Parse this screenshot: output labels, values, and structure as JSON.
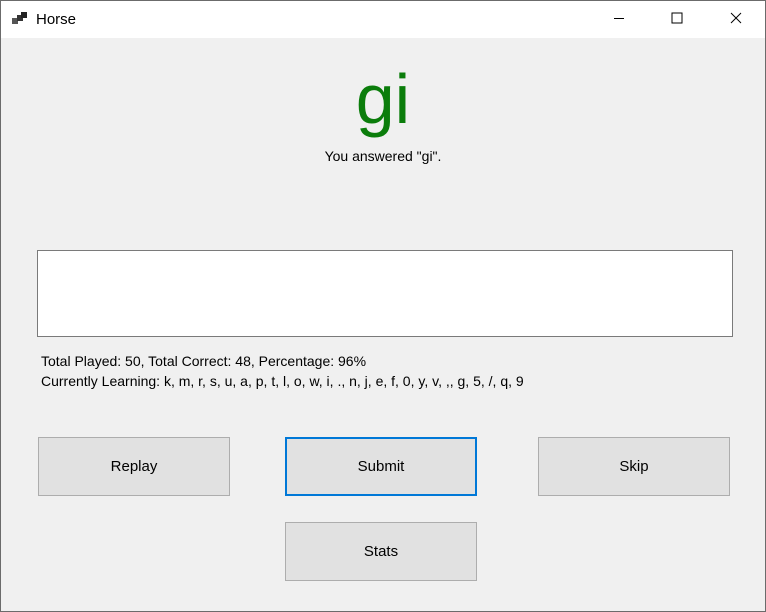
{
  "window": {
    "title": "Horse"
  },
  "answer": {
    "display": "gi",
    "message": "You answered \"gi\".",
    "color": "#0b7d0b"
  },
  "input": {
    "value": "",
    "placeholder": ""
  },
  "stats": {
    "summary": "Total Played: 50, Total Correct: 48, Percentage: 96%",
    "learning": "Currently Learning: k, m, r, s, u, a, p, t, l, o, w, i, ., n, j, e, f, 0, y, v, ,, g, 5, /, q, 9"
  },
  "buttons": {
    "replay": "Replay",
    "submit": "Submit",
    "skip": "Skip",
    "stats": "Stats"
  },
  "titlebar_icons": [
    "app-icon",
    "minimize-icon",
    "maximize-icon",
    "close-icon"
  ],
  "colors": {
    "focus": "#0078d7",
    "button_bg": "#e1e1e1",
    "window_bg": "#f0f0f0"
  }
}
